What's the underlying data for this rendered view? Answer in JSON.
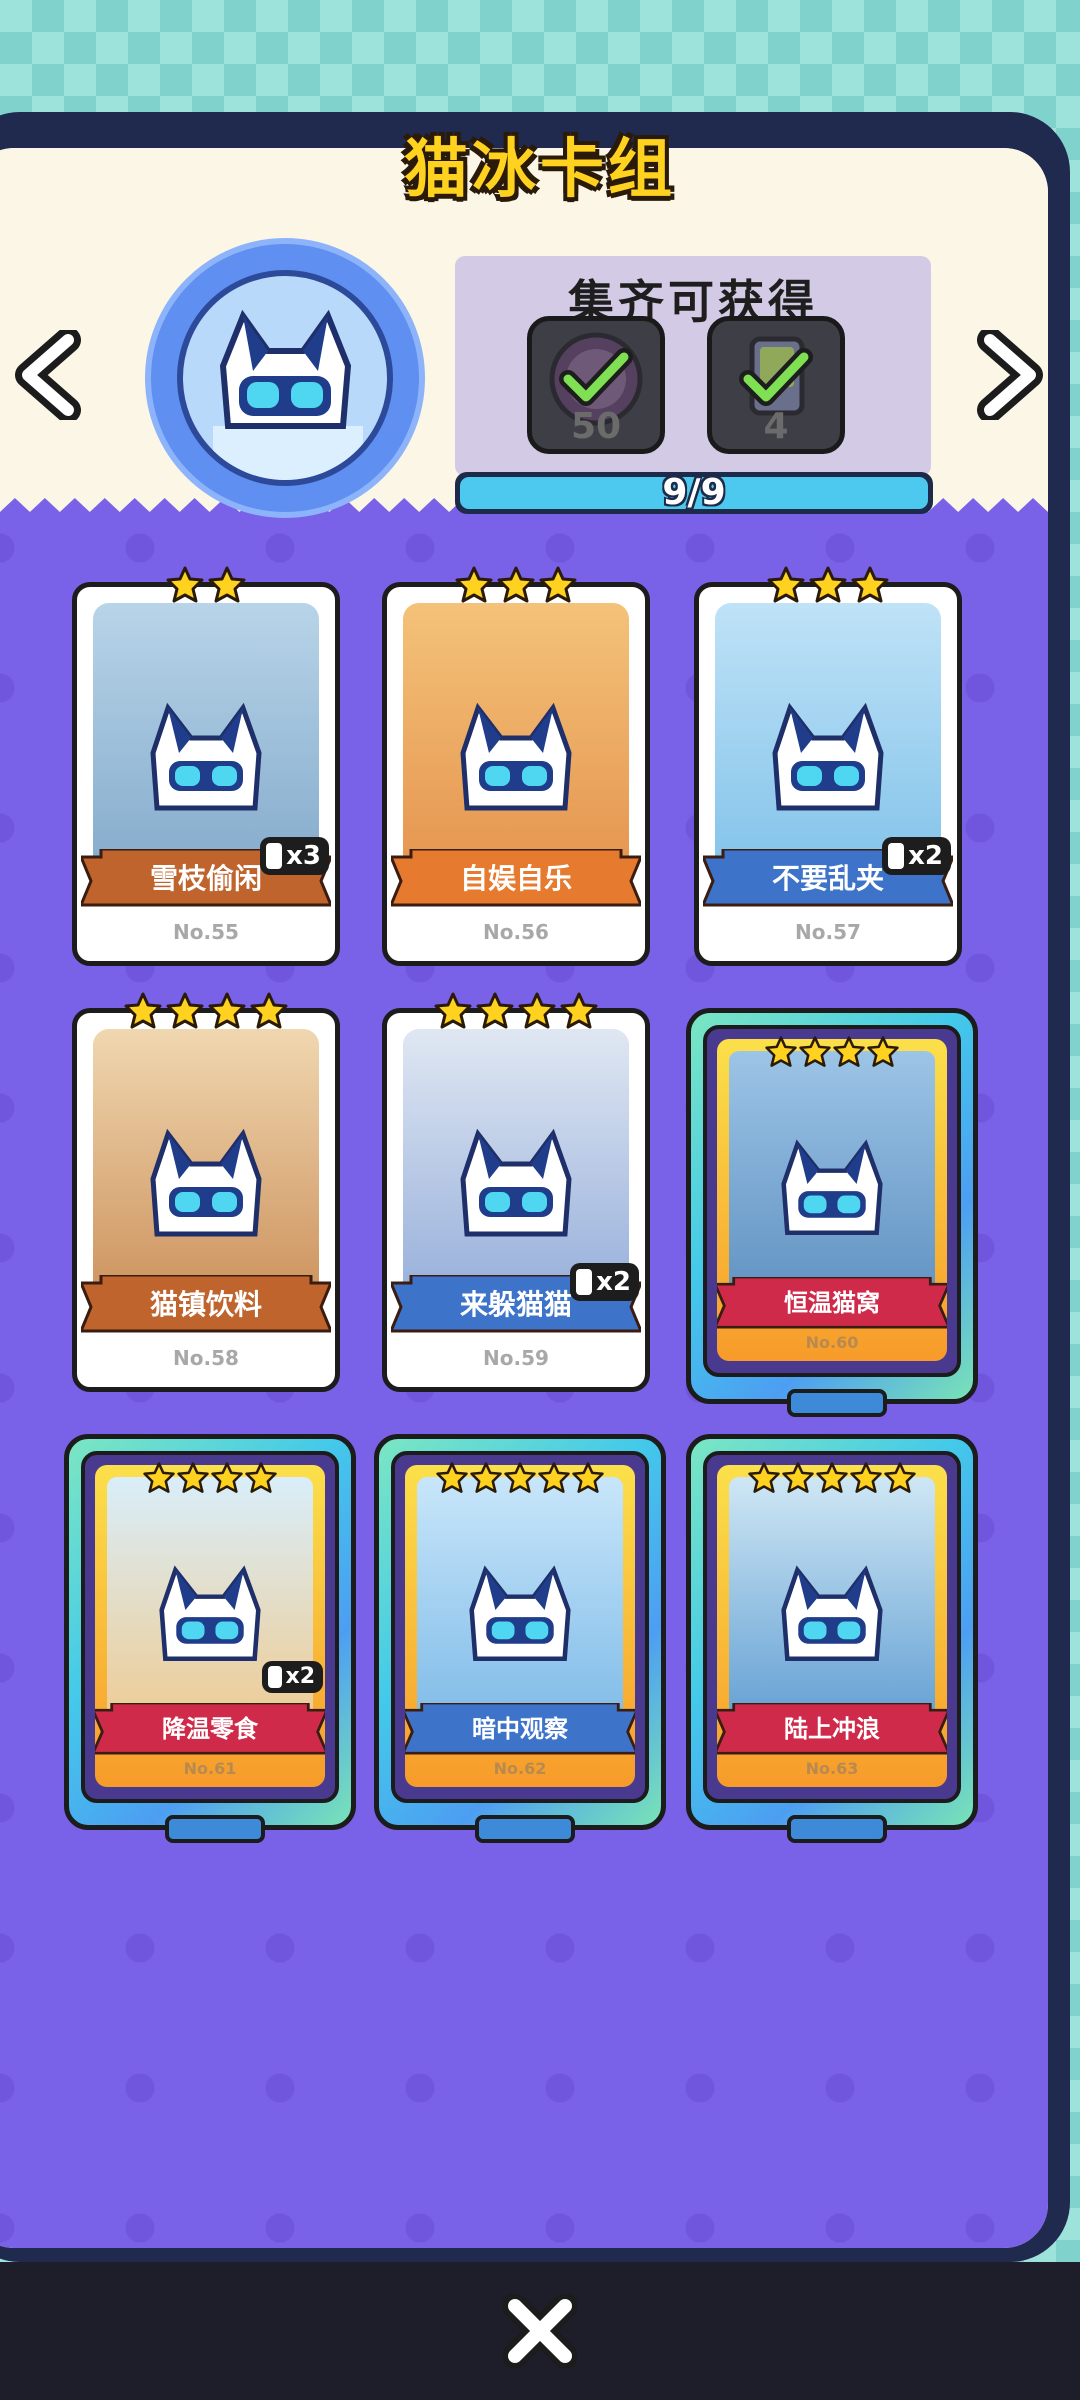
{
  "header": {
    "title": "猫冰卡组"
  },
  "rewards": {
    "title": "集齐可获得",
    "items": [
      {
        "amount": "50",
        "icon": "cat-badge-icon",
        "claimed": true
      },
      {
        "amount": "4",
        "icon": "card-pack-icon",
        "claimed": true
      }
    ]
  },
  "progress": {
    "label": "9/9",
    "collected": 9,
    "total": 9
  },
  "cards": [
    {
      "name": "雪枝偷闲",
      "no": "No.55",
      "stars": 2,
      "duplicate": "x3",
      "ribbon": "#c0642e",
      "art": [
        "#b8d4e8",
        "#7fa7c9"
      ]
    },
    {
      "name": "自娱自乐",
      "no": "No.56",
      "stars": 3,
      "duplicate": "",
      "ribbon": "#e67a2e",
      "art": [
        "#f4c27a",
        "#e3904a"
      ]
    },
    {
      "name": "不要乱夹",
      "no": "No.57",
      "stars": 3,
      "duplicate": "x2",
      "ribbon": "#3d73c9",
      "art": [
        "#bfe2f7",
        "#7cc0e8"
      ]
    },
    {
      "name": "猫镇饮料",
      "no": "No.58",
      "stars": 4,
      "duplicate": "",
      "ribbon": "#c0642e",
      "art": [
        "#f0d7b0",
        "#c98b55"
      ]
    },
    {
      "name": "来躲猫猫",
      "no": "No.59",
      "stars": 4,
      "duplicate": "x2",
      "ribbon": "#3d73c9",
      "art": [
        "#dfe7f2",
        "#8fa9d8"
      ]
    },
    {
      "name": "恒温猫窝",
      "no": "No.60",
      "stars": 4,
      "duplicate": "",
      "ribbon": "#d02a4b",
      "art": [
        "#9cc4e6",
        "#5d8fc0"
      ],
      "rare": true
    },
    {
      "name": "降温零食",
      "no": "No.61",
      "stars": 4,
      "duplicate": "x2",
      "ribbon": "#d02a4b",
      "art": [
        "#d9eefa",
        "#f0c98c"
      ],
      "rare": true
    },
    {
      "name": "暗中观察",
      "no": "No.62",
      "stars": 5,
      "duplicate": "",
      "ribbon": "#3d73c9",
      "art": [
        "#c8e6fa",
        "#7ab8e6"
      ],
      "rare": true
    },
    {
      "name": "陆上冲浪",
      "no": "No.63",
      "stars": 5,
      "duplicate": "",
      "ribbon": "#d02a4b",
      "art": [
        "#cfe7f4",
        "#5a9ad0"
      ],
      "rare": true
    }
  ],
  "controls": {
    "prev_icon": "chevron-left-icon",
    "next_icon": "chevron-right-icon",
    "close_icon": "close-icon"
  },
  "colors": {
    "accent_yellow": "#ffd21f",
    "panel_purple": "#7a62e8",
    "progress_blue": "#4dc9ef"
  }
}
